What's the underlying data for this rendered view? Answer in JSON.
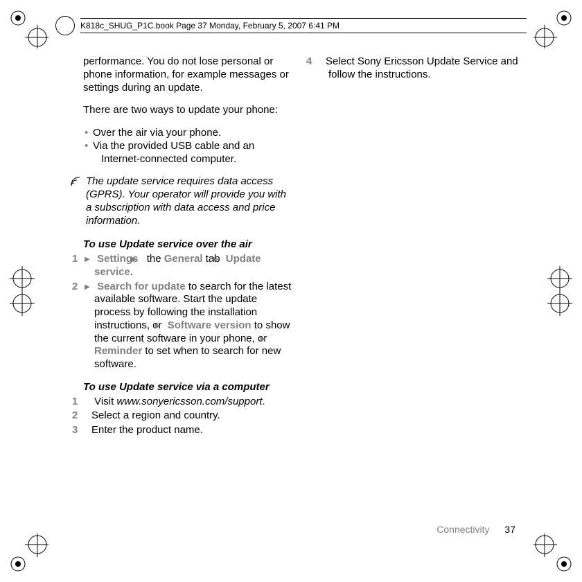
{
  "header": {
    "title": "K818c_SHUG_P1C.book  Page 37  Monday, February 5, 2007  6:41 PM"
  },
  "left_col": {
    "intro1": "performance. You do not lose personal or phone information, for example messages or settings during an update.",
    "intro2": "There are two ways to update your phone:",
    "bullets": [
      "Over the air via your phone.",
      "Via the provided USB cable and an Internet-connected computer."
    ],
    "note": "The update service requires data access (GPRS). Your operator will provide you with a subscription with data access and price information.",
    "ota_head": "To use Update service over the air",
    "ota_step1_a": "Settings",
    "ota_step1_b": " the ",
    "ota_step1_c": "General",
    "ota_step1_d": " tab ",
    "ota_step1_e": "Update service",
    "ota_step1_end": ".",
    "ota_step2_a": "Search for update",
    "ota_step2_b": " to search for the latest available software. Start the update process by following the installation instructions, or ",
    "ota_step2_c": "Software version",
    "ota_step2_d": " to show the current software in your phone, or ",
    "ota_step2_e": "Reminder",
    "ota_step2_f": " to set when to search for new software.",
    "pc_head": "To use Update service via a computer",
    "pc_step1_a": "Visit ",
    "pc_step1_b": "www.sonyericsson.com/support",
    "pc_step1_c": ".",
    "pc_step2": "Select a region and country.",
    "pc_step3": "Enter the product name."
  },
  "right_col": {
    "step4": "Select Sony Ericsson Update Service and follow the instructions."
  },
  "footer": {
    "section": "Connectivity",
    "page": "37"
  }
}
